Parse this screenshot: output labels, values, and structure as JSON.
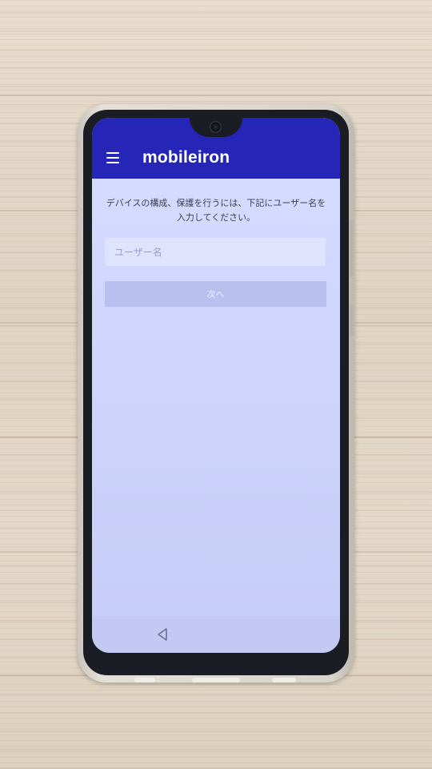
{
  "app": {
    "brand": "mobileiron"
  },
  "header": {
    "menu_icon": "hamburger-menu-icon"
  },
  "main": {
    "instruction": "デバイスの構成、保護を行うには、下記にユーザー名を入力してください。",
    "username_placeholder": "ユーザー名",
    "username_value": "",
    "next_label": "次へ"
  },
  "navbar": {
    "back_icon": "back-triangle-icon"
  },
  "colors": {
    "appbar": "#2526b8",
    "screen_bg": "#d7ddff",
    "next_button_disabled": "#b9c0ef"
  }
}
